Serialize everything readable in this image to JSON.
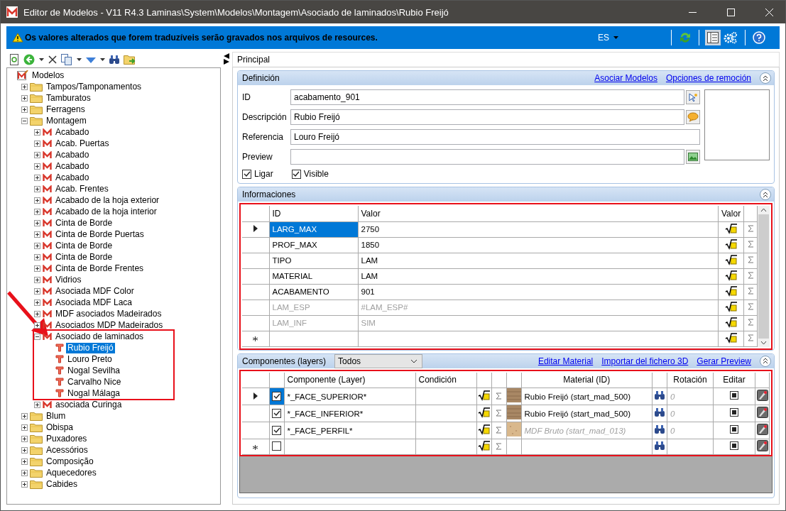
{
  "window": {
    "title": "Editor de Modelos - V11 R4.3 Laminas\\System\\Modelos\\Montagem\\Asociado de laminados\\Rubio Freijó"
  },
  "banner": {
    "message": "Os valores alterados que forem traduzíveis serão gravados nos arquivos de resources.",
    "language": "ES"
  },
  "tree": {
    "arrow": true,
    "nodes": [
      {
        "label": "Modelos",
        "kind": "root",
        "selected": false,
        "children": [
          {
            "label": "Tampos/Tamponamentos",
            "kind": "folder",
            "expanded": false,
            "selected": false
          },
          {
            "label": "Tamburatos",
            "kind": "folder",
            "expanded": false,
            "selected": false
          },
          {
            "label": "Ferragens",
            "kind": "folder",
            "expanded": false,
            "selected": false
          },
          {
            "label": "Montagem",
            "kind": "folder",
            "expanded": true,
            "selected": false,
            "children": [
              {
                "label": "Acabado",
                "kind": "model",
                "expanded": false,
                "selected": false
              },
              {
                "label": "Acab. Puertas",
                "kind": "model",
                "expanded": false,
                "selected": false
              },
              {
                "label": "Acabado",
                "kind": "model",
                "expanded": false,
                "selected": false
              },
              {
                "label": "Acabado",
                "kind": "model",
                "expanded": false,
                "selected": false
              },
              {
                "label": "Acabado",
                "kind": "model",
                "expanded": false,
                "selected": false
              },
              {
                "label": "Acab. Frentes",
                "kind": "model",
                "expanded": false,
                "selected": false
              },
              {
                "label": "Acabado de la hoja exterior",
                "kind": "model",
                "expanded": false,
                "selected": false
              },
              {
                "label": "Acabado de la hoja interior",
                "kind": "model",
                "expanded": false,
                "selected": false
              },
              {
                "label": "Cinta de Borde",
                "kind": "model",
                "expanded": false,
                "selected": false
              },
              {
                "label": "Cinta de Borde Puertas",
                "kind": "model",
                "expanded": false,
                "selected": false
              },
              {
                "label": "Cinta de Borde",
                "kind": "model",
                "expanded": false,
                "selected": false
              },
              {
                "label": "Cinta de Borde",
                "kind": "model",
                "expanded": false,
                "selected": false
              },
              {
                "label": "Cinta de Borde Frentes",
                "kind": "model",
                "expanded": false,
                "selected": false
              },
              {
                "label": "Vidrios",
                "kind": "model",
                "expanded": false,
                "selected": false
              },
              {
                "label": "Asociada MDF Color",
                "kind": "model",
                "expanded": false,
                "selected": false
              },
              {
                "label": "Asociada MDF Laca",
                "kind": "model",
                "expanded": false,
                "selected": false
              },
              {
                "label": "MDF asociados Madeirados",
                "kind": "model",
                "expanded": false,
                "selected": false
              },
              {
                "label": "Asociados MDP Madeirados",
                "kind": "model",
                "expanded": false,
                "selected": false
              },
              {
                "label": "Asociado de laminados",
                "kind": "model",
                "expanded": true,
                "selected": false,
                "highlighted": true,
                "children": [
                  {
                    "label": "Rubio Freijó",
                    "kind": "item",
                    "selected": true
                  },
                  {
                    "label": "Louro Preto",
                    "kind": "item",
                    "selected": false
                  },
                  {
                    "label": "Nogal Sevilha",
                    "kind": "item",
                    "selected": false
                  },
                  {
                    "label": "Carvalho Nice",
                    "kind": "item",
                    "selected": false
                  },
                  {
                    "label": "Nogal Málaga",
                    "kind": "item",
                    "selected": false
                  }
                ]
              },
              {
                "label": "asociada Curinga",
                "kind": "model",
                "expanded": false,
                "selected": false
              }
            ]
          },
          {
            "label": "Blum",
            "kind": "folder",
            "expanded": false,
            "selected": false
          },
          {
            "label": "Obispa",
            "kind": "folder",
            "expanded": false,
            "selected": false
          },
          {
            "label": "Puxadores",
            "kind": "folder",
            "expanded": false,
            "selected": false
          },
          {
            "label": "Acessórios",
            "kind": "folder",
            "expanded": false,
            "selected": false
          },
          {
            "label": "Composição",
            "kind": "folder",
            "expanded": false,
            "selected": false
          },
          {
            "label": "Aquecedores",
            "kind": "folder",
            "expanded": false,
            "selected": false
          },
          {
            "label": "Cabides",
            "kind": "folder",
            "expanded": false,
            "selected": false
          }
        ]
      }
    ]
  },
  "tab": "Principal",
  "definicion": {
    "title": "Definición",
    "links": [
      "Asociar Modelos",
      "Opciones de remoción"
    ],
    "fields": [
      {
        "label": "ID",
        "value": "acabamento_901",
        "kind": "pick"
      },
      {
        "label": "Descripción",
        "value": "Rubio Freijó",
        "kind": "speech"
      },
      {
        "label": "Referencia",
        "value": "Louro Freijó",
        "kind": "plain"
      },
      {
        "label": "Preview",
        "kind": "image"
      }
    ],
    "checkboxes": [
      {
        "label": "Ligar",
        "checked": true
      },
      {
        "label": "Visible",
        "checked": true
      }
    ]
  },
  "informaciones": {
    "title": "Informaciones",
    "highlighted": true,
    "columns": [
      "ID",
      "Valor",
      "Valor"
    ],
    "rows": [
      {
        "kind": "data",
        "id": "LARG_MAX",
        "value": "2750",
        "selected": true,
        "disabled": false
      },
      {
        "kind": "data",
        "id": "PROF_MAX",
        "value": "1850",
        "selected": false,
        "disabled": false
      },
      {
        "kind": "data",
        "id": "TIPO",
        "value": "LAM",
        "selected": false,
        "disabled": false
      },
      {
        "kind": "data",
        "id": "MATERIAL",
        "value": "LAM",
        "selected": false,
        "disabled": false
      },
      {
        "kind": "data",
        "id": "ACABAMENTO",
        "value": "901",
        "selected": false,
        "disabled": false
      },
      {
        "kind": "data",
        "id": "LAM_ESP",
        "value": "#LAM_ESP#",
        "selected": false,
        "disabled": true
      },
      {
        "kind": "data",
        "id": "LAM_INF",
        "value": "SIM",
        "selected": false,
        "disabled": true
      },
      {
        "kind": "new",
        "selected": false
      }
    ]
  },
  "componentes": {
    "title": "Componentes (layers)",
    "filter": "Todos",
    "highlighted": true,
    "links": [
      "Editar Material",
      "Importar del fichero 3D",
      "Gerar Preview"
    ],
    "columns": [
      "Componente (Layer)",
      "Condición",
      "Material (ID)",
      "Rotación",
      "Editar"
    ],
    "rows": [
      {
        "kind": "wood",
        "checked": true,
        "name": "*_FACE_SUPERIOR*",
        "material": "Rubio Freijó (start_mad_500)",
        "inherited": false,
        "rotation": "0",
        "selected": true
      },
      {
        "kind": "wood",
        "checked": true,
        "name": "*_FACE_INFERIOR*",
        "material": "Rubio Freijó (start_mad_500)",
        "inherited": false,
        "rotation": "0",
        "selected": false
      },
      {
        "kind": "mdf",
        "checked": true,
        "name": "*_FACE_PERFIL*",
        "material": "MDF Bruto (start_mad_013)",
        "inherited": true,
        "rotation": "0",
        "selected": false
      },
      {
        "kind": "new",
        "checked": false,
        "selected": false
      }
    ]
  }
}
